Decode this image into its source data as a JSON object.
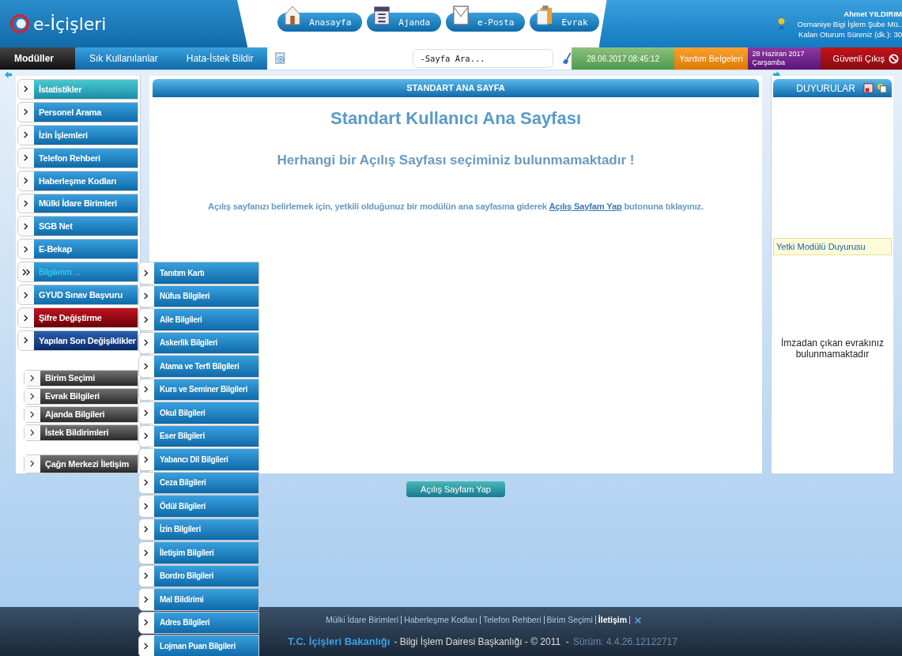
{
  "header": {
    "logo": "e-İçişleri",
    "nav": [
      {
        "label": "Anasayfa",
        "kind": "home"
      },
      {
        "label": "Ajanda",
        "kind": "calendar"
      },
      {
        "label": "e-Posta",
        "kind": "mail"
      },
      {
        "label": "Evrak",
        "kind": "clipboard"
      }
    ],
    "user": {
      "name": "Ahmet YILDIRIM",
      "unit": "Osmaniye Bigi İşlem Şube Mü..",
      "session": "Kalan Oturum Süreniz (dk.): 30"
    }
  },
  "toolbar": {
    "tabs": [
      {
        "label": "Modüller",
        "selected": true
      },
      {
        "label": "Sık Kullanılanlar",
        "selected": false
      },
      {
        "label": "Hata-İstek Bildir",
        "selected": false
      }
    ],
    "search": {
      "placeholder": "-Sayfa Ara..."
    },
    "datetime": "28.06.2017 08:45:12",
    "help": "Yardım Belgeleri",
    "date": "28 Haziran 2017",
    "weekday": "Çarşamba",
    "logout": "Güvenli Çıkış"
  },
  "sidebar": {
    "items": [
      {
        "label": "İstatistikler",
        "kind": "teal",
        "selected": false
      },
      {
        "label": "Personel Arama",
        "kind": "blue",
        "selected": false
      },
      {
        "label": "İzin İşlemleri",
        "kind": "blue",
        "selected": false
      },
      {
        "label": "Telefon Rehberi",
        "kind": "blue",
        "selected": false
      },
      {
        "label": "Haberleşme Kodları",
        "kind": "blue",
        "selected": false
      },
      {
        "label": "Mülki İdare Birimleri",
        "kind": "blue",
        "selected": false
      },
      {
        "label": "SGB Net",
        "kind": "blue",
        "selected": false
      },
      {
        "label": "E-Bekap",
        "kind": "blue",
        "selected": false
      },
      {
        "label": "Bilgilerim ...",
        "kind": "blue",
        "selected": true
      },
      {
        "label": "GYUD Sınav Başvuru",
        "kind": "blue",
        "selected": false
      },
      {
        "label": "Şifre Değiştirme",
        "kind": "red",
        "selected": false
      },
      {
        "label": "Yapılan Son Değişiklikler",
        "kind": "navy",
        "selected": false
      }
    ],
    "secondary": [
      {
        "label": "Birim Seçimi"
      },
      {
        "label": "Evrak Bilgileri"
      },
      {
        "label": "Ajanda Bilgileri"
      },
      {
        "label": "İstek Bildirimleri"
      }
    ],
    "contact": "Çağrı Merkezi İletişim",
    "submenu": [
      "Tanıtım Kartı",
      "Nüfus Bilgileri",
      "Aile Bilgileri",
      "Askerlik Bilgileri",
      "Atama ve Terfi Bilgileri",
      "Kurs ve Seminer Bilgileri",
      "Okul Bilgileri",
      "Eser Bilgileri",
      "Yabancı Dil Bilgileri",
      "Ceza Bilgileri",
      "Ödül Bilgileri",
      "İzin Bilgileri",
      "İletişim Bilgileri",
      "Bordro Bilgileri",
      "Mal Bildirimi",
      "Adres Bilgileri",
      "Lojman Puan Bilgileri"
    ]
  },
  "main": {
    "header": "STANDART ANA SAYFA",
    "title": "Standart Kullanıcı Ana Sayfası",
    "notice": "Herhangi bir Açılış Sayfası seçiminiz bulunmamaktadır !",
    "hint_before": "Açılış sayfanızı belirlemek için, yetkili olduğunuz bir modülün ana sayfasına giderek",
    "hint_link": "Açılış Sayfam Yap",
    "hint_after": "butonuna tıklayınız.",
    "button": "Açılış Sayfam Yap"
  },
  "announcements": {
    "header": "DUYURULAR",
    "notice": "Yetki Modülü Duyurusu",
    "message": "İmzadan çıkan evrakınız bulunmamaktadır"
  },
  "footer": {
    "links": [
      {
        "label": "Mülki İdare Birimleri",
        "bold": false
      },
      {
        "label": "Haberleşme Kodları",
        "bold": false
      },
      {
        "label": "Telefon Rehberi",
        "bold": false
      },
      {
        "label": "Birim Seçimi",
        "bold": false
      },
      {
        "label": "İletişim",
        "bold": true
      }
    ],
    "org": "T.C. İçişleri Bakanlığı",
    "dept": "- Bilgi İşlem Dairesi Başkanlığı - © 2011  -",
    "version": "Sürüm: 4.4.26.12122717"
  }
}
